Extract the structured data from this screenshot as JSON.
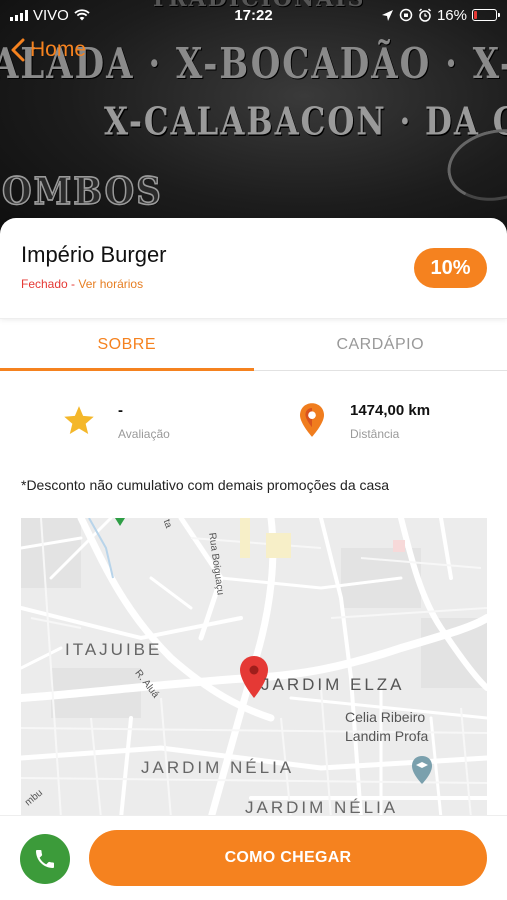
{
  "status_bar": {
    "carrier": "VIVO",
    "time": "17:22",
    "battery_percent": "16%",
    "battery_level": 0.16,
    "icons": [
      "signal-icon",
      "wifi-icon",
      "location-arrow-icon",
      "screen-lock-icon",
      "alarm-icon",
      "battery-charging-icon"
    ]
  },
  "nav": {
    "back_label": "Home"
  },
  "hero": {
    "lines": [
      "TRADICIONAIS",
      "ALADA · X-BOCADÃO · X-BACON · X-CALAB",
      "X-CALABACON · DA CASA",
      "OMBOS"
    ]
  },
  "store": {
    "name": "Império Burger",
    "status": "Fechado",
    "separator": " - ",
    "hours_link": "Ver horários",
    "discount": "10%"
  },
  "tabs": [
    {
      "label": "SOBRE",
      "active": true
    },
    {
      "label": "CARDÁPIO",
      "active": false
    }
  ],
  "info": {
    "rating_value": "-",
    "rating_label": "Avaliação",
    "distance_value": "1474,00 km",
    "distance_label": "Distância"
  },
  "disclaimer": "*Desconto não cumulativo com demais promoções da casa",
  "map": {
    "labels": {
      "street_1": "Rua Boiguaçu",
      "street_2": "R. Aluá",
      "street_3": "ta",
      "neighborhood_1": "ITAJUIBE",
      "neighborhood_2": "JARDIM ELZA",
      "neighborhood_3": "JARDIM NÉLIA",
      "neighborhood_4": "JARDIM NÉLIA",
      "poi_line1": "Celia Ribeiro",
      "poi_line2": "Landim Profa",
      "edge": "mbu"
    }
  },
  "actions": {
    "directions_label": "COMO CHEGAR"
  },
  "colors": {
    "accent": "#f5821f",
    "closed": "#e53935",
    "call": "#3c9b3a",
    "pin": "#e53935"
  }
}
